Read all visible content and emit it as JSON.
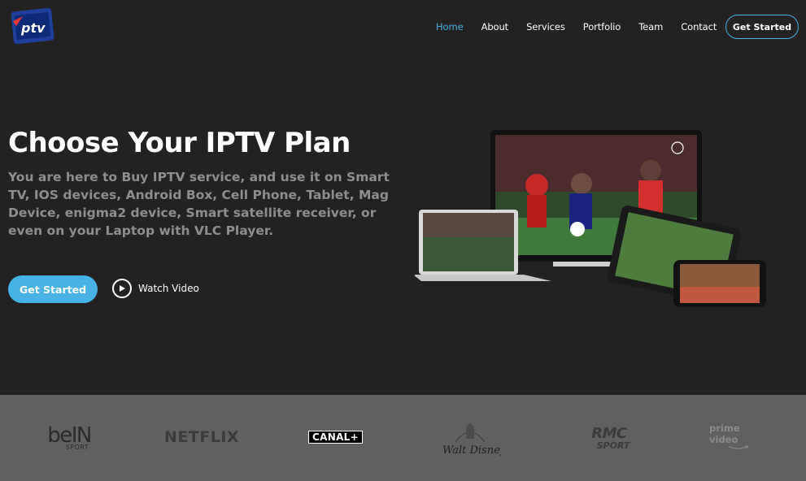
{
  "header": {
    "logo_text": "ptv",
    "nav": [
      {
        "label": "Home",
        "active": true
      },
      {
        "label": "About",
        "active": false
      },
      {
        "label": "Services",
        "active": false
      },
      {
        "label": "Portfolio",
        "active": false
      },
      {
        "label": "Team",
        "active": false
      },
      {
        "label": "Contact",
        "active": false
      }
    ],
    "cta_label": "Get Started"
  },
  "hero": {
    "title": "Choose Your IPTV Plan",
    "subtitle": "You are here to Buy IPTV service, and use it on Smart TV, IOS devices, Android Box, Cell Phone, Tablet, Mag Device, enigma2 device, Smart satellite receiver, or even on your Laptop with VLC Player.",
    "primary_button": "Get Started",
    "watch_video": "Watch Video",
    "image_icon": "devices-showcase-image"
  },
  "brands": {
    "bein_main": "beIN",
    "bein_sub": "SPORT",
    "netflix": "NETFLIX",
    "canal": "CANAL+",
    "disney": "Walt Disney",
    "rmc_main": "RMC",
    "rmc_sub": "SPORT",
    "prime": "prime video"
  },
  "colors": {
    "accent": "#47b2e4",
    "background": "#232122",
    "brand_strip": "#5f6062",
    "subtitle_text": "#8f8e8f"
  }
}
